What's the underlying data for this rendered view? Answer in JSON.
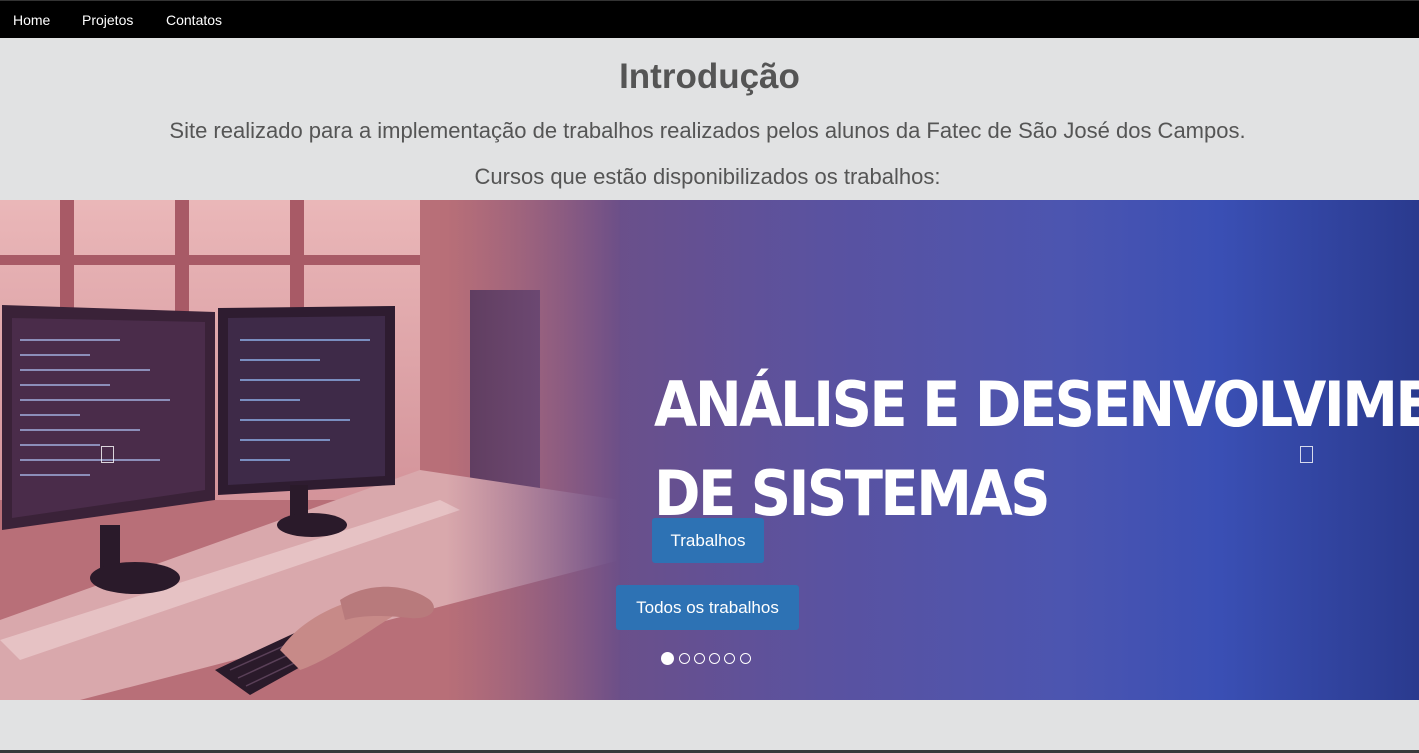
{
  "nav": {
    "items": [
      {
        "label": "Home"
      },
      {
        "label": "Projetos"
      },
      {
        "label": "Contatos"
      }
    ]
  },
  "intro": {
    "title": "Introdução",
    "description": "Site realizado para a implementação de trabalhos realizados pelos alunos da Fatec de São José dos Campos.",
    "courses_label": "Cursos que estão disponibilizados os trabalhos:"
  },
  "carousel": {
    "slide_title_line1": "ANÁLISE E DESENVOLVIMENTO",
    "slide_title_line2": "DE SISTEMAS",
    "button_trabalhos": "Trabalhos",
    "button_todos": "Todos os trabalhos",
    "prev_icon": "chevron-left-icon",
    "next_icon": "chevron-right-icon",
    "indicator_count": 6,
    "active_indicator": 0
  },
  "colors": {
    "nav_bg": "#000000",
    "page_bg": "#e1e2e3",
    "text": "#555555",
    "button": "#2d72b4"
  }
}
